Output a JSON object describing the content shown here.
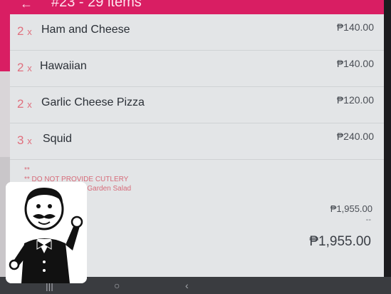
{
  "header": {
    "back_icon": "arrow-left-icon",
    "title": "#23 - 29 items"
  },
  "items": [
    {
      "qty": "2",
      "unit": "x",
      "name": "Ham and Cheese",
      "price": "₱140.00"
    },
    {
      "qty": "2",
      "unit": "x",
      "name": "Hawaiian",
      "price": "₱140.00"
    },
    {
      "qty": "2",
      "unit": "x",
      "name": "Garlic Cheese Pizza",
      "price": "₱120.00"
    },
    {
      "qty": "3",
      "unit": "x",
      "name": "Squid",
      "price": "₱240.00"
    }
  ],
  "notes": {
    "marker": "**",
    "line1": "** DO NOT PROVIDE CUTLERY",
    "line2": "gift discount: FREE Garden Salad"
  },
  "summary": {
    "subtotal": "₱1,955.00",
    "dash": "--",
    "total": "₱1,955.00"
  },
  "navbar": {
    "recents_icon": "recents-icon",
    "home_icon": "home-icon",
    "back_icon": "back-triangle-icon"
  },
  "colors": {
    "accent": "#d91e63",
    "qty": "#e0707e",
    "note": "#d66b79"
  }
}
